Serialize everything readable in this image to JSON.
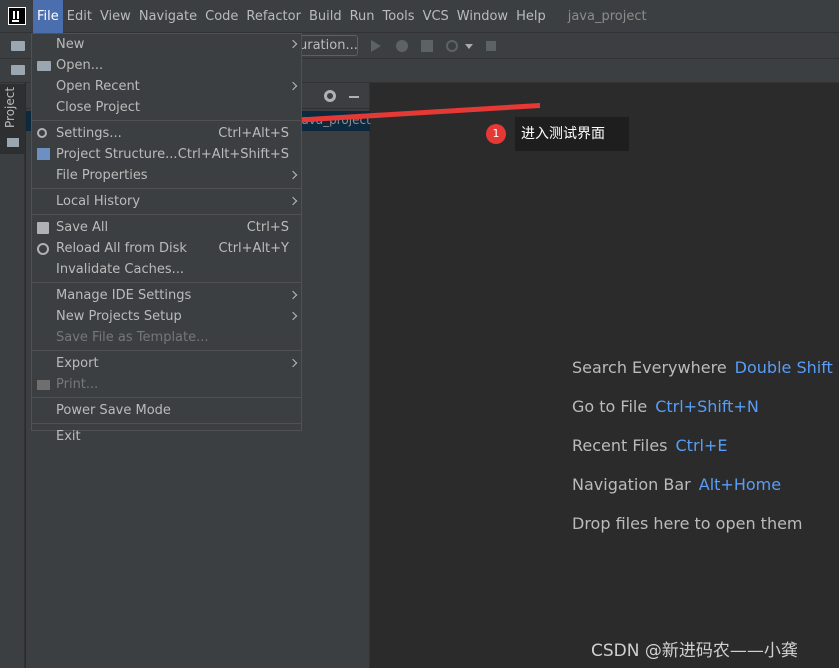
{
  "menubar": {
    "items": [
      "File",
      "Edit",
      "View",
      "Navigate",
      "Code",
      "Refactor",
      "Build",
      "Run",
      "Tools",
      "VCS",
      "Window",
      "Help"
    ],
    "project_title": "java_project"
  },
  "toolbar": {
    "run_config_label": "uration..."
  },
  "stripe": {
    "project_label": "Project"
  },
  "project_panel": {
    "tree_root_text": "java_project"
  },
  "file_menu": {
    "items": [
      {
        "label": "New",
        "icon": "",
        "shortcut": "",
        "submenu": true,
        "disabled": false
      },
      {
        "label": "Open...",
        "icon": "folder-icon",
        "shortcut": "",
        "submenu": false,
        "disabled": false
      },
      {
        "label": "Open Recent",
        "icon": "",
        "shortcut": "",
        "submenu": true,
        "disabled": false
      },
      {
        "label": "Close Project",
        "icon": "",
        "shortcut": "",
        "submenu": false,
        "disabled": false
      },
      {
        "sep": true
      },
      {
        "label": "Settings...",
        "icon": "wrench-icon",
        "shortcut": "Ctrl+Alt+S",
        "submenu": false,
        "disabled": false
      },
      {
        "label": "Project Structure...",
        "icon": "project-structure-icon",
        "shortcut": "Ctrl+Alt+Shift+S",
        "submenu": false,
        "disabled": false
      },
      {
        "label": "File Properties",
        "icon": "",
        "shortcut": "",
        "submenu": true,
        "disabled": false
      },
      {
        "sep": true
      },
      {
        "label": "Local History",
        "icon": "",
        "shortcut": "",
        "submenu": true,
        "disabled": false
      },
      {
        "sep": true
      },
      {
        "label": "Save All",
        "icon": "save-icon",
        "shortcut": "Ctrl+S",
        "submenu": false,
        "disabled": false
      },
      {
        "label": "Reload All from Disk",
        "icon": "reload-icon",
        "shortcut": "Ctrl+Alt+Y",
        "submenu": false,
        "disabled": false
      },
      {
        "label": "Invalidate Caches...",
        "icon": "",
        "shortcut": "",
        "submenu": false,
        "disabled": false
      },
      {
        "sep": true
      },
      {
        "label": "Manage IDE Settings",
        "icon": "",
        "shortcut": "",
        "submenu": true,
        "disabled": false
      },
      {
        "label": "New Projects Setup",
        "icon": "",
        "shortcut": "",
        "submenu": true,
        "disabled": false
      },
      {
        "label": "Save File as Template...",
        "icon": "",
        "shortcut": "",
        "submenu": false,
        "disabled": true
      },
      {
        "sep": true
      },
      {
        "label": "Export",
        "icon": "",
        "shortcut": "",
        "submenu": true,
        "disabled": false
      },
      {
        "label": "Print...",
        "icon": "print-icon",
        "shortcut": "",
        "submenu": false,
        "disabled": true
      },
      {
        "sep": true
      },
      {
        "label": "Power Save Mode",
        "icon": "",
        "shortcut": "",
        "submenu": false,
        "disabled": false
      },
      {
        "sep": true
      },
      {
        "label": "Exit",
        "icon": "",
        "shortcut": "",
        "submenu": false,
        "disabled": false
      }
    ]
  },
  "editor_hints": [
    {
      "label": "Search Everywhere",
      "key": "Double Shift"
    },
    {
      "label": "Go to File",
      "key": "Ctrl+Shift+N"
    },
    {
      "label": "Recent Files",
      "key": "Ctrl+E"
    },
    {
      "label": "Navigation Bar",
      "key": "Alt+Home"
    },
    {
      "label": "Drop files here to open them",
      "key": ""
    }
  ],
  "annotation": {
    "badge": "1",
    "text": "进入测试界面",
    "color": "#e53935"
  },
  "watermark": "CSDN @新进码农——小龚"
}
